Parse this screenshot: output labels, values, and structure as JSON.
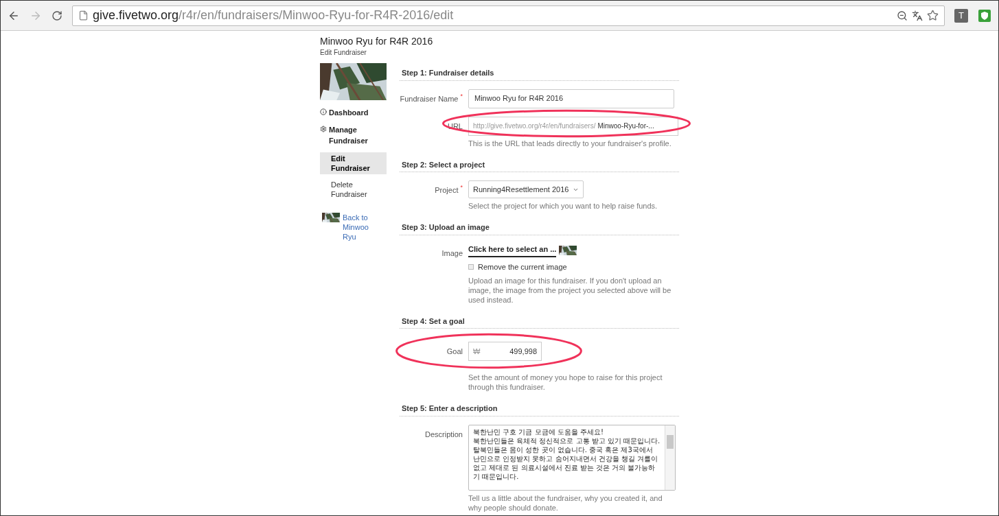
{
  "browser": {
    "url_host": "give.fivetwo.org",
    "url_path": "/r4r/en/fundraisers/Minwoo-Ryu-for-R4R-2016/edit",
    "extension_letter": "T"
  },
  "page": {
    "title": "Minwoo Ryu for R4R 2016",
    "subtitle": "Edit Fundraiser"
  },
  "sidebar": {
    "items": [
      {
        "kind": "heading",
        "label": "Dashboard",
        "selected": false
      },
      {
        "kind": "heading",
        "label": "Manage Fundraiser",
        "selected": false
      },
      {
        "kind": "sub",
        "label": "Edit Fundraiser",
        "selected": true
      },
      {
        "kind": "sub",
        "label": "Delete Fundraiser",
        "selected": false
      }
    ],
    "back_link": "Back to Minwoo Ryu"
  },
  "steps": [
    {
      "title": "Step 1: Fundraiser details",
      "fields": [
        {
          "kind": "text",
          "label": "Fundraiser Name",
          "required_mark": "*",
          "value": "Minwoo Ryu for R4R 2016",
          "highlighted": false
        },
        {
          "kind": "url",
          "label": "URL",
          "prefix": "http://give.fivetwo.org/r4r/en/fundraisers/",
          "value": "Minwoo-Ryu-for-...",
          "help": "This is the URL that leads directly to your fundraiser's profile.",
          "highlighted": true
        }
      ]
    },
    {
      "title": "Step 2: Select a project",
      "fields": [
        {
          "kind": "select",
          "label": "Project",
          "required_mark": "*",
          "value": "Running4Resettlement 2016",
          "help": "Select the project for which you want to help raise funds.",
          "highlighted": false
        }
      ]
    },
    {
      "title": "Step 3: Upload an image",
      "fields": [
        {
          "label": "Image",
          "value": "Click here to select an ...",
          "checkbox": {
            "label": "Remove the current image",
            "checked": false
          },
          "help": "Upload an image for this fundraiser. If you don't upload an image, the image from the project you selected above will be used instead.",
          "highlighted": false
        }
      ]
    },
    {
      "title": "Step 4: Set a goal",
      "fields": [
        {
          "kind": "money",
          "label": "Goal",
          "currency": "₩",
          "value": "499,998",
          "help": "Set the amount of money you hope to raise for this project through this fundraiser.",
          "highlighted": true
        }
      ]
    },
    {
      "title": "Step 5: Enter a description",
      "fields": [
        {
          "kind": "textarea",
          "label": "Description",
          "value": "북한난민 구호 기금 모금에 도움을 주세요!\n북한난민들은 육체적 정신적으로 고통 받고 있기 때문입니다. 탈북민들은 몸이 성한 곳이 없습니다. 중국 혹은 제3국에서 난민으로 인정받지 못하고 숨어지내면서 건강을 챙길 겨를이 없고 제대로 된 의료시설에서 진료 받는 것은 거의 불가능하기 때문입니다.",
          "help": "Tell us a little about the fundraiser, why you created it, and why people should donate.",
          "highlighted": false
        }
      ]
    }
  ]
}
